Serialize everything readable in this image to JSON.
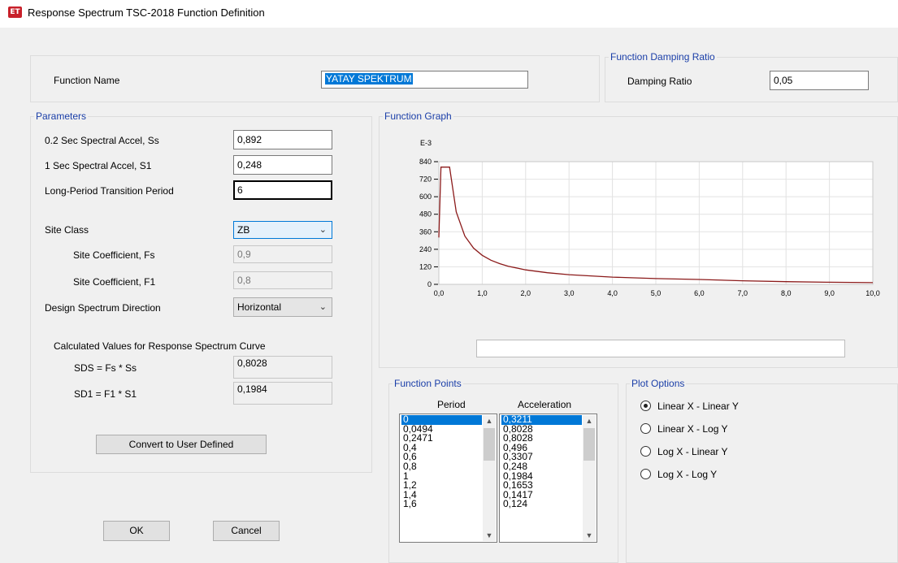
{
  "window": {
    "icon_text": "ET",
    "title": "Response Spectrum TSC-2018 Function Definition"
  },
  "function_name": {
    "label": "Function Name",
    "value": "YATAY SPEKTRUM"
  },
  "damping": {
    "group_title": "Function Damping Ratio",
    "label": "Damping Ratio",
    "value": "0,05"
  },
  "parameters": {
    "group_title": "Parameters",
    "ss_label": "0.2 Sec Spectral Accel, Ss",
    "ss_value": "0,892",
    "s1_label": "1 Sec Spectral Accel, S1",
    "s1_value": "0,248",
    "tl_label": "Long-Period Transition Period",
    "tl_value": "6",
    "site_class_label": "Site Class",
    "site_class_value": "ZB",
    "fs_label": "Site Coefficient, Fs",
    "fs_value": "0,9",
    "f1_label": "Site Coefficient, F1",
    "f1_value": "0,8",
    "direction_label": "Design Spectrum Direction",
    "direction_value": "Horizontal",
    "calc_heading": "Calculated Values for Response Spectrum Curve",
    "sds_label": "SDS =  Fs * Ss",
    "sds_value": "0,8028",
    "sd1_label": "SD1 =  F1 * S1",
    "sd1_value": "0,1984",
    "convert_button": "Convert to User Defined"
  },
  "buttons": {
    "ok": "OK",
    "cancel": "Cancel"
  },
  "graph": {
    "group_title": "Function Graph"
  },
  "chart_data": {
    "type": "line",
    "exponent_label": "E-3",
    "xlim": [
      0,
      10
    ],
    "ylim": [
      0,
      840
    ],
    "x_ticks": [
      "0,0",
      "1,0",
      "2,0",
      "3,0",
      "4,0",
      "5,0",
      "6,0",
      "7,0",
      "8,0",
      "9,0",
      "10,0"
    ],
    "y_ticks": [
      "0",
      "120",
      "240",
      "360",
      "480",
      "600",
      "720",
      "840"
    ],
    "grid": true,
    "line_color": "#8b1a1a",
    "series": [
      {
        "x": [
          0,
          0.0494,
          0.2471,
          0.4,
          0.6,
          0.8,
          1,
          1.2,
          1.4,
          1.6,
          2,
          2.5,
          3,
          4,
          5,
          6,
          7,
          8,
          9,
          10
        ],
        "y": [
          321.1,
          802.8,
          802.8,
          496,
          330.7,
          248,
          198.4,
          165.3,
          141.7,
          124,
          99.2,
          79.4,
          66.1,
          49.6,
          39.7,
          33.1,
          24.3,
          18.6,
          14.7,
          11.9
        ]
      }
    ]
  },
  "points": {
    "group_title": "Function Points",
    "period_header": "Period",
    "accel_header": "Acceleration",
    "periods": [
      "0",
      "0,0494",
      "0,2471",
      "0,4",
      "0,6",
      "0,8",
      "1",
      "1,2",
      "1,4",
      "1,6"
    ],
    "accelerations": [
      "0,3211",
      "0,8028",
      "0,8028",
      "0,496",
      "0,3307",
      "0,248",
      "0,1984",
      "0,1653",
      "0,1417",
      "0,124"
    ]
  },
  "plot_options": {
    "group_title": "Plot Options",
    "options": [
      "Linear X - Linear Y",
      "Linear X - Log Y",
      "Log X - Linear Y",
      "Log X - Log Y"
    ],
    "selected_index": 0
  }
}
